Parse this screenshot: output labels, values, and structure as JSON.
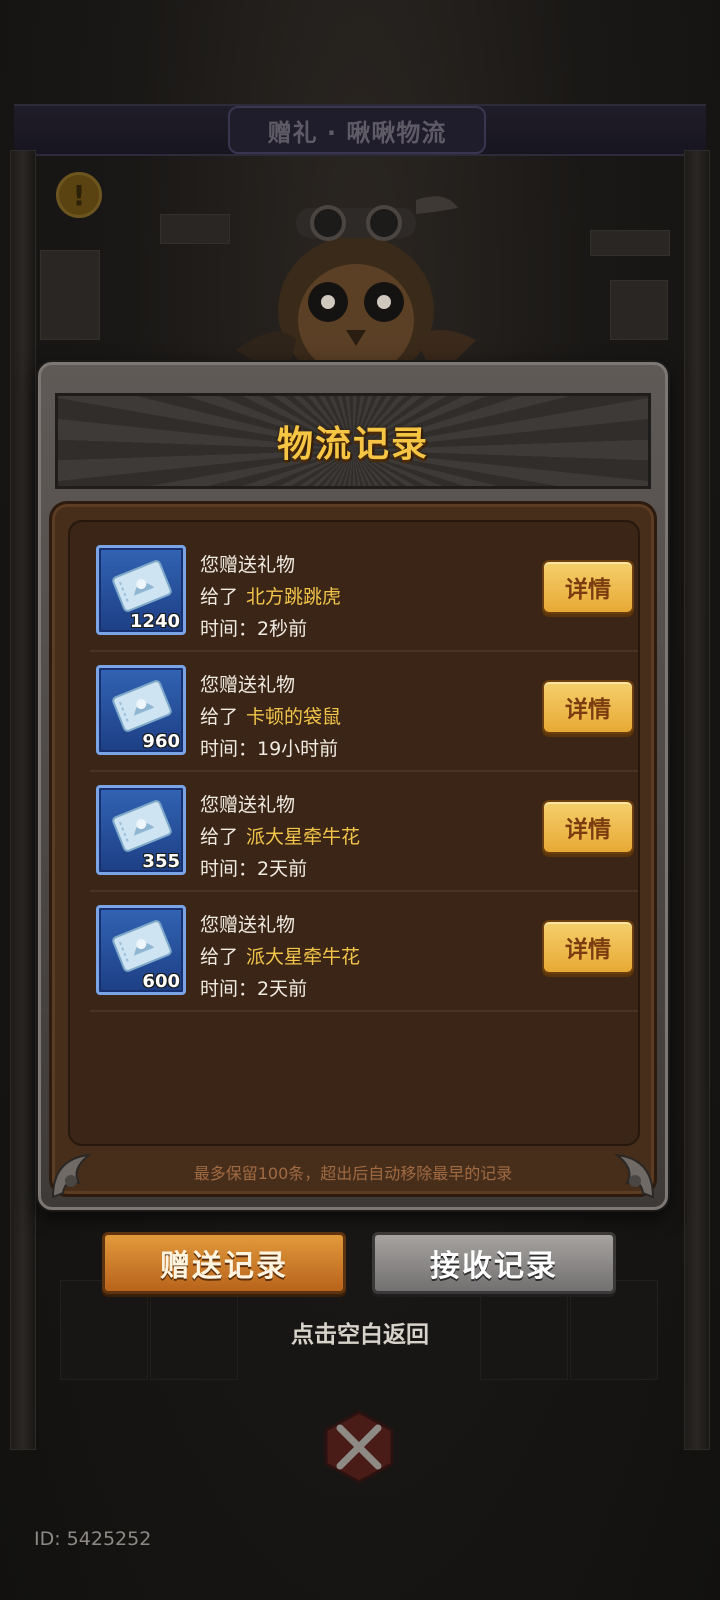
{
  "background": {
    "title": "赠礼 · 啾啾物流"
  },
  "panel": {
    "title": "物流记录",
    "footer_note": "最多保留100条，超出后自动移除最早的记录",
    "records": [
      {
        "gift_count": "1240",
        "line1": "您赠送礼物",
        "line2_prefix": "给了",
        "recipient": "北方跳跳虎",
        "time": "时间：2秒前",
        "detail_label": "详情"
      },
      {
        "gift_count": "960",
        "line1": "您赠送礼物",
        "line2_prefix": "给了",
        "recipient": "卡顿的袋鼠",
        "time": "时间：19小时前",
        "detail_label": "详情"
      },
      {
        "gift_count": "355",
        "line1": "您赠送礼物",
        "line2_prefix": "给了",
        "recipient": "派大星牵牛花",
        "time": "时间：2天前",
        "detail_label": "详情"
      },
      {
        "gift_count": "600",
        "line1": "您赠送礼物",
        "line2_prefix": "给了",
        "recipient": "派大星牵牛花",
        "time": "时间：2天前",
        "detail_label": "详情"
      }
    ]
  },
  "tabs": {
    "send_label": "赠送记录",
    "receive_label": "接收记录",
    "active": "send"
  },
  "return_label": "点击空白返回",
  "user_id": "ID: 5425252",
  "colors": {
    "title_gold": "#f6c544",
    "recipient_gold": "#f2c44a",
    "list_bg": "#3a2516",
    "button_gold": "#e7a935"
  }
}
